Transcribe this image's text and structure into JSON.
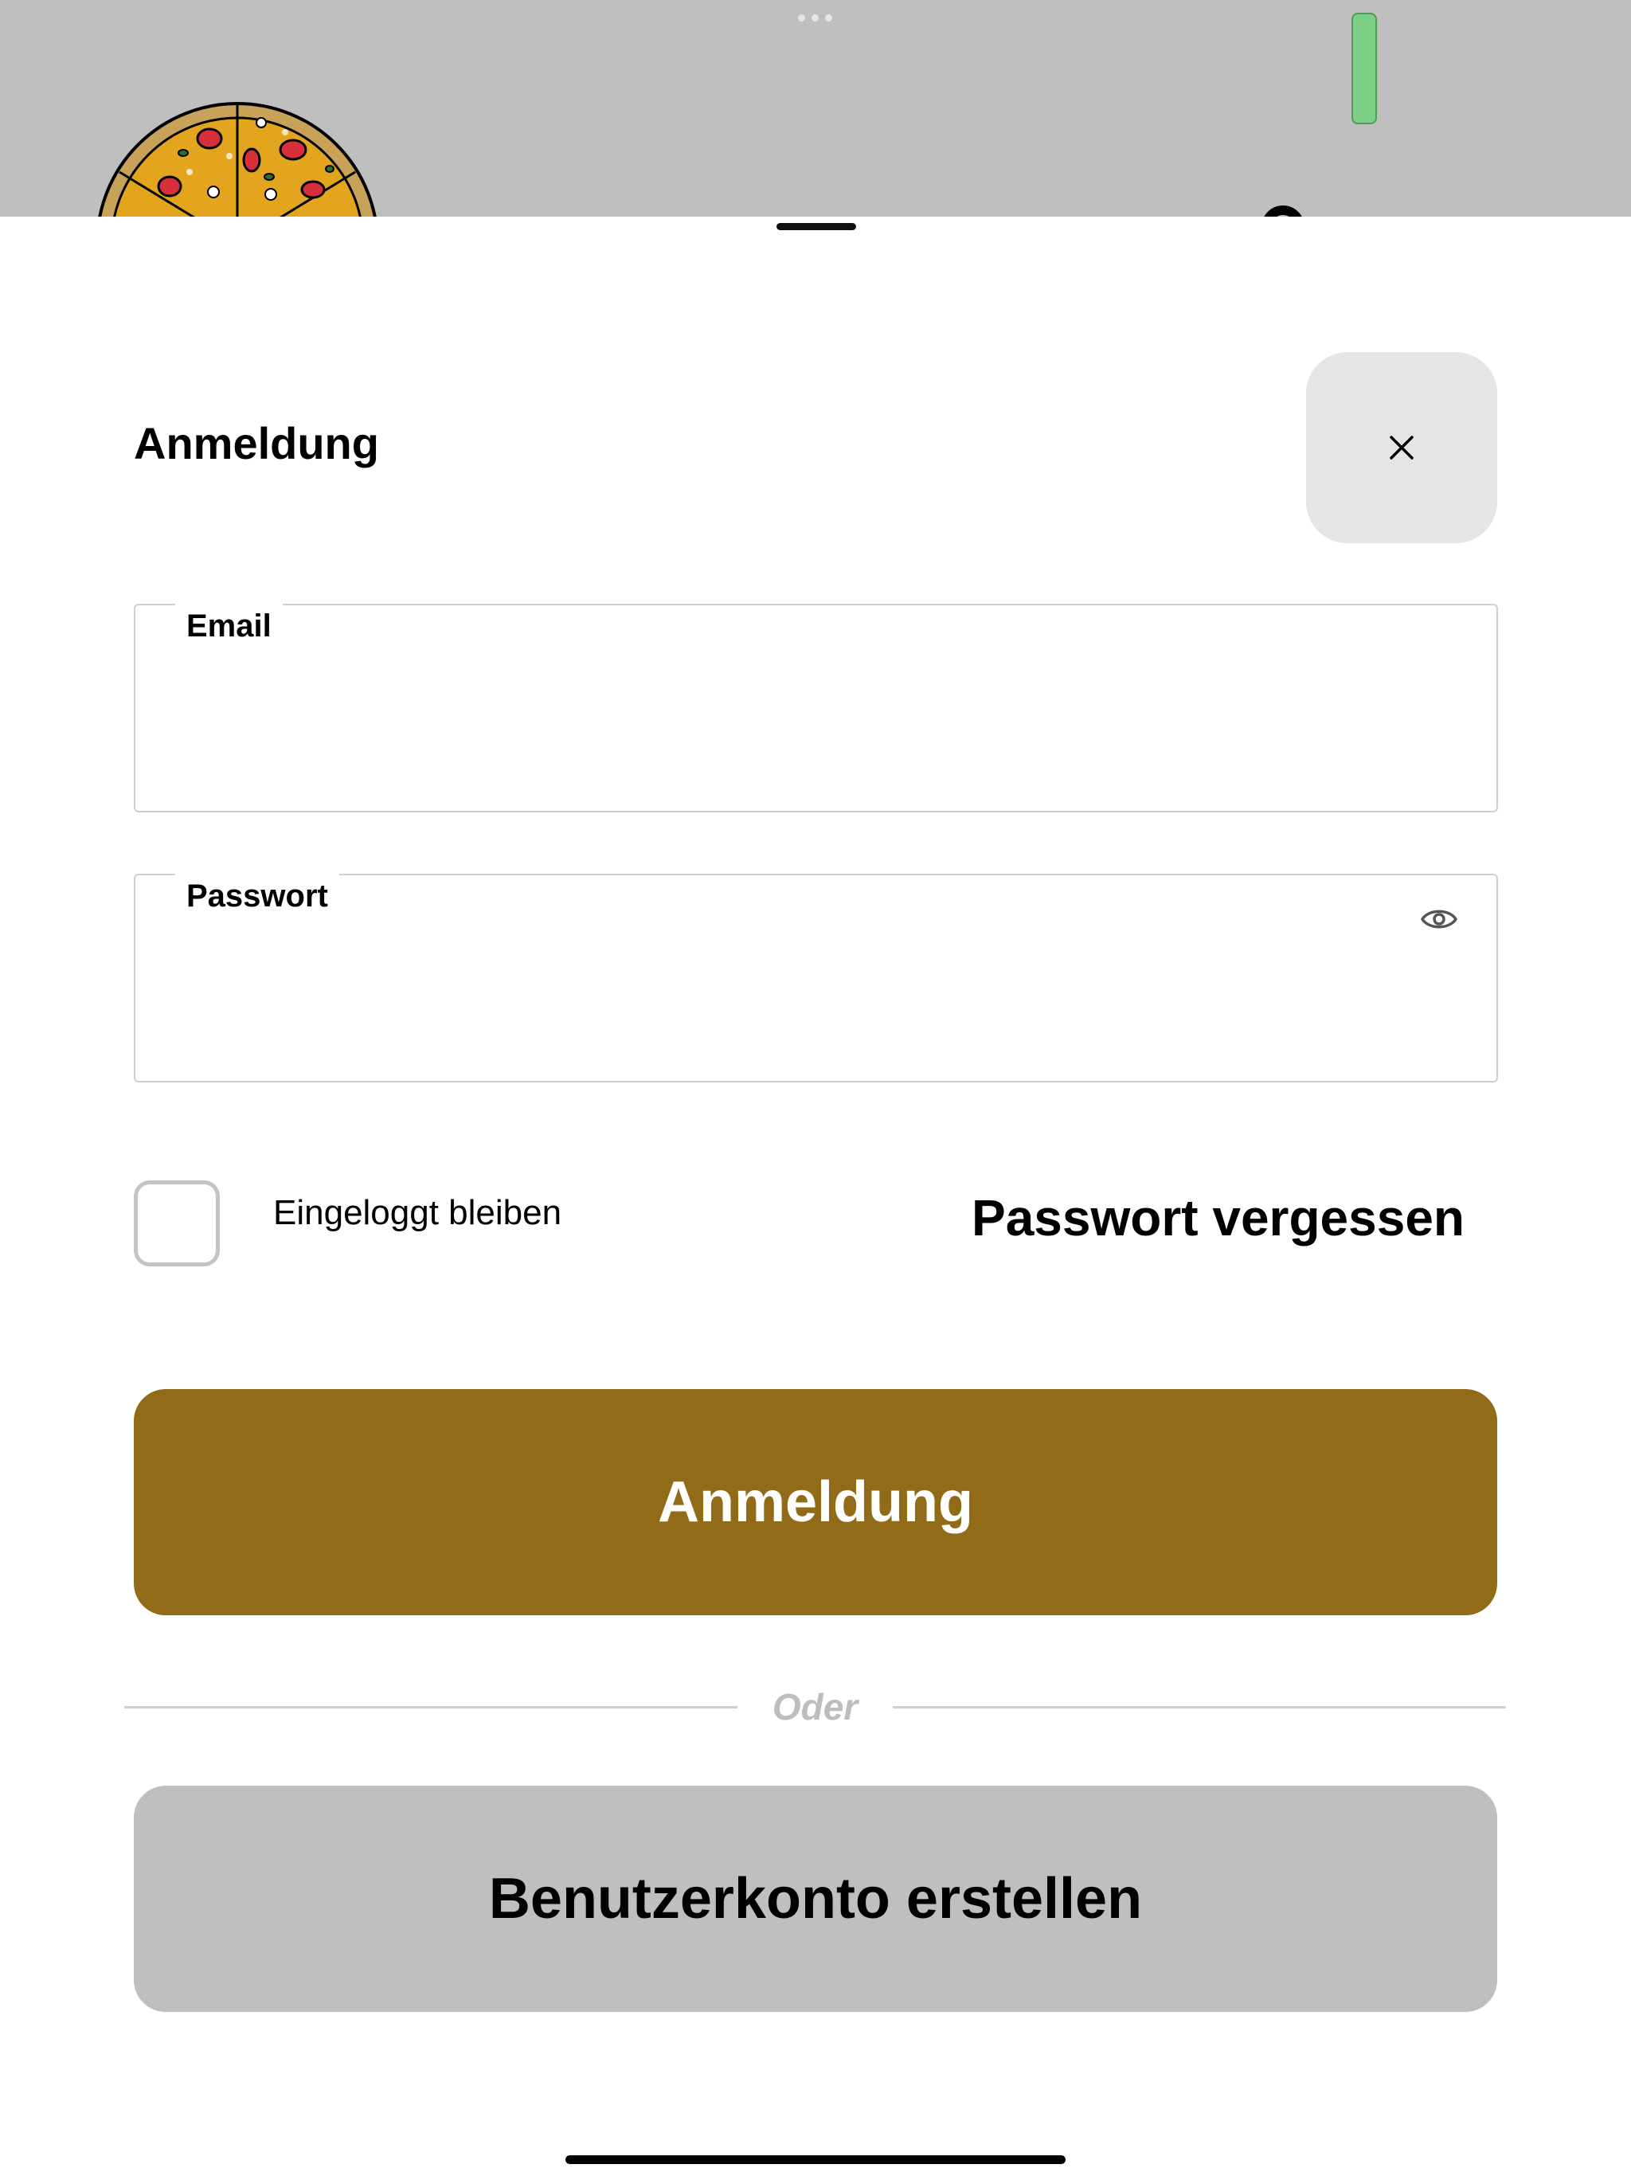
{
  "sheet": {
    "title": "Anmeldung"
  },
  "form": {
    "email": {
      "label": "Email",
      "value": "",
      "placeholder": ""
    },
    "password": {
      "label": "Passwort",
      "value": "",
      "placeholder": ""
    },
    "remember_me": {
      "label": "Eingeloggt bleiben",
      "checked": false
    },
    "forgot_password_label": "Passwort vergessen"
  },
  "actions": {
    "login_label": "Anmeldung",
    "separator_label": "Oder",
    "register_label": "Benutzerkonto erstellen"
  },
  "colors": {
    "primary": "#926b18",
    "secondary_button": "#bfbfbf",
    "close_button_bg": "#e5e5e5",
    "backdrop": "#bfbfbf",
    "battery": "#7ccf84"
  },
  "icons": {
    "close": "close-icon",
    "password_visibility": "eye-icon",
    "brand": "pizza-logo-icon"
  }
}
